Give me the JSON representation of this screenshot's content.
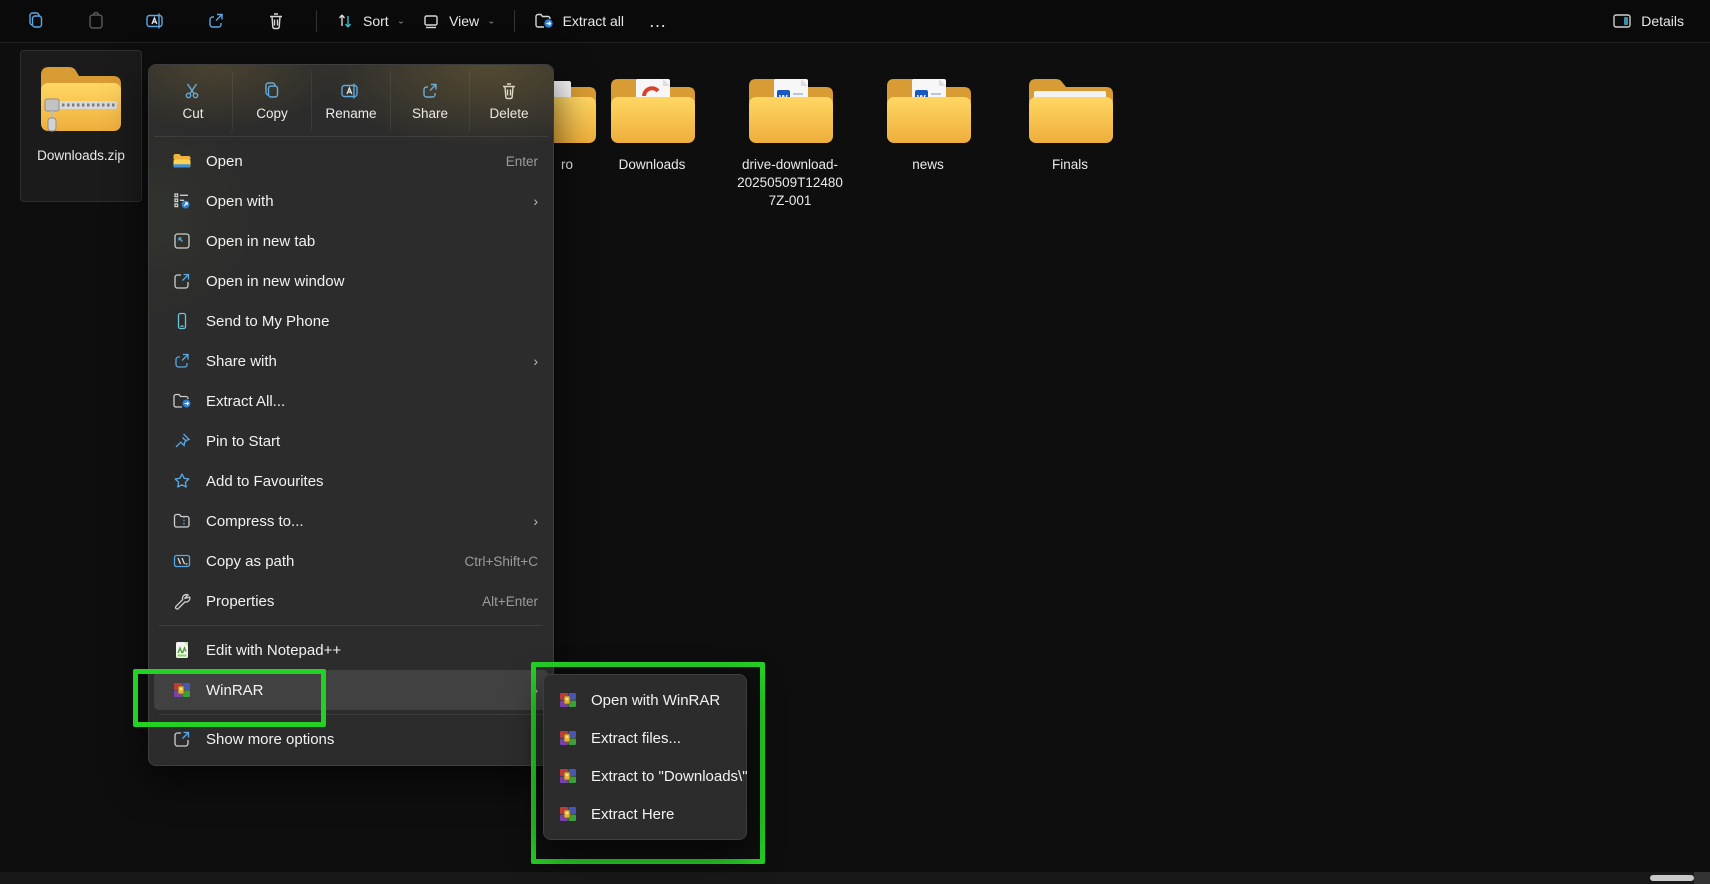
{
  "toolbar": {
    "icon_buttons": [
      "copy",
      "paste",
      "rename",
      "share",
      "delete"
    ],
    "sort_label": "Sort",
    "view_label": "View",
    "extract_all_label": "Extract all",
    "more_label": "…",
    "details_label": "Details"
  },
  "files": {
    "selected": {
      "label": "Downloads.zip"
    },
    "partial_label": "ro",
    "folders": [
      {
        "label": "Downloads"
      },
      {
        "lines": [
          "drive-download-",
          "20250509T12480",
          "7Z-001"
        ]
      },
      {
        "label": "news"
      },
      {
        "label": "Finals"
      }
    ]
  },
  "context_menu": {
    "command_bar": [
      "Cut",
      "Copy",
      "Rename",
      "Share",
      "Delete"
    ],
    "items": [
      {
        "label": "Open",
        "shortcut": "Enter"
      },
      {
        "label": "Open with",
        "submenu": true
      },
      {
        "label": "Open in new tab"
      },
      {
        "label": "Open in new window"
      },
      {
        "label": "Send to My Phone"
      },
      {
        "label": "Share with",
        "submenu": true
      },
      {
        "label": "Extract All..."
      },
      {
        "label": "Pin to Start"
      },
      {
        "label": "Add to Favourites"
      },
      {
        "label": "Compress to...",
        "submenu": true
      },
      {
        "label": "Copy as path",
        "shortcut": "Ctrl+Shift+C"
      },
      {
        "label": "Properties",
        "shortcut": "Alt+Enter"
      },
      {
        "label": "Edit with Notepad++"
      },
      {
        "label": "WinRAR",
        "submenu": true,
        "highlighted": true
      },
      {
        "label": "Show more options"
      }
    ]
  },
  "winrar_submenu": {
    "items": [
      {
        "label": "Open with WinRAR"
      },
      {
        "label": "Extract files..."
      },
      {
        "label": "Extract to \"Downloads\\\""
      },
      {
        "label": "Extract Here"
      }
    ]
  },
  "colors": {
    "annotation_green": "#25d025",
    "accent_blue": "#5aa9e6",
    "folder_yellow": "#f5bd4a",
    "menu_bg": "#2c2c2c"
  }
}
